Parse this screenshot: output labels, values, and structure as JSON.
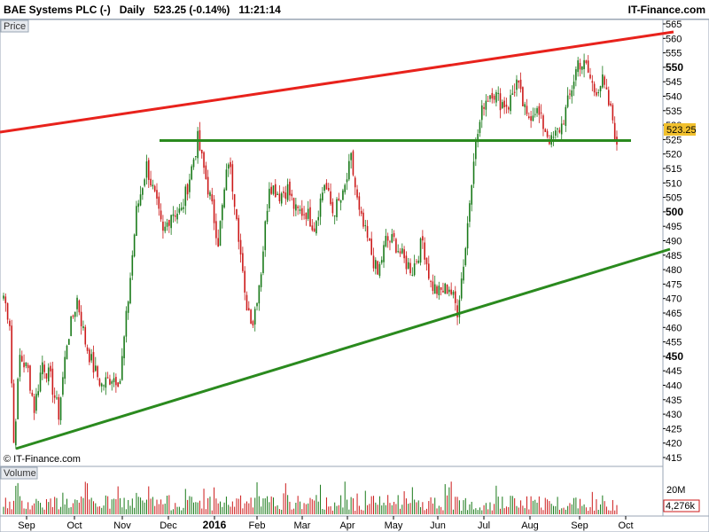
{
  "header": {
    "title": "BAE Systems PLC (-)   Daily   523.25 (-0.14%)   11:21:14",
    "brand": "IT-Finance.com"
  },
  "panes": {
    "price_label": "Price",
    "volume_label": "Volume",
    "copyright": "© IT-Finance.com"
  },
  "colors": {
    "up": "#1a7a1a",
    "down": "#cc1a1a",
    "resistance": "#e8221c",
    "support": "#2a8a1e",
    "horizontal": "#2a8a1e",
    "last_badge": "#f2c12e",
    "volume_badge": "#cc1a1a"
  },
  "chart_data": {
    "type": "candlestick",
    "y_range": [
      415,
      565
    ],
    "y_ticks": [
      415,
      420,
      425,
      430,
      435,
      440,
      445,
      450,
      455,
      460,
      465,
      470,
      475,
      480,
      485,
      490,
      495,
      500,
      505,
      510,
      515,
      520,
      525,
      530,
      535,
      540,
      545,
      550,
      555,
      560,
      565
    ],
    "y_bold": [
      450,
      500,
      550
    ],
    "x_labels": [
      "Sep",
      "Oct",
      "Nov",
      "Dec",
      "2016",
      "Feb",
      "Mar",
      "Apr",
      "May",
      "Jun",
      "Jul",
      "Aug",
      "Sep",
      "Oct"
    ],
    "x_bold": [
      "2016"
    ],
    "last_price": "523.25",
    "volume_ticks": [
      "20M"
    ],
    "last_volume": "4,276k",
    "anchors": [
      [
        0,
        471
      ],
      [
        3,
        462
      ],
      [
        5,
        420
      ],
      [
        8,
        450
      ],
      [
        12,
        445
      ],
      [
        15,
        432
      ],
      [
        19,
        448
      ],
      [
        23,
        442
      ],
      [
        27,
        430
      ],
      [
        31,
        455
      ],
      [
        36,
        470
      ],
      [
        40,
        455
      ],
      [
        44,
        446
      ],
      [
        48,
        440
      ],
      [
        53,
        443
      ],
      [
        57,
        442
      ],
      [
        61,
        470
      ],
      [
        65,
        500
      ],
      [
        70,
        516
      ],
      [
        74,
        505
      ],
      [
        78,
        492
      ],
      [
        82,
        500
      ],
      [
        87,
        500
      ],
      [
        91,
        512
      ],
      [
        95,
        525
      ],
      [
        97,
        518
      ],
      [
        101,
        505
      ],
      [
        105,
        490
      ],
      [
        110,
        518
      ],
      [
        114,
        500
      ],
      [
        118,
        470
      ],
      [
        122,
        462
      ],
      [
        126,
        480
      ],
      [
        130,
        510
      ],
      [
        135,
        506
      ],
      [
        139,
        508
      ],
      [
        143,
        500
      ],
      [
        148,
        500
      ],
      [
        152,
        495
      ],
      [
        157,
        510
      ],
      [
        161,
        500
      ],
      [
        166,
        505
      ],
      [
        170,
        518
      ],
      [
        174,
        499
      ],
      [
        179,
        488
      ],
      [
        183,
        478
      ],
      [
        187,
        490
      ],
      [
        191,
        490
      ],
      [
        196,
        483
      ],
      [
        200,
        480
      ],
      [
        205,
        490
      ],
      [
        209,
        475
      ],
      [
        213,
        472
      ],
      [
        218,
        474
      ],
      [
        222,
        466
      ],
      [
        226,
        488
      ],
      [
        230,
        520
      ],
      [
        235,
        538
      ],
      [
        239,
        542
      ],
      [
        243,
        538
      ],
      [
        247,
        537
      ],
      [
        251,
        545
      ],
      [
        256,
        532
      ],
      [
        260,
        536
      ],
      [
        264,
        530
      ],
      [
        268,
        524
      ],
      [
        273,
        530
      ],
      [
        277,
        540
      ],
      [
        281,
        552
      ],
      [
        285,
        550
      ],
      [
        289,
        542
      ],
      [
        293,
        545
      ],
      [
        298,
        532
      ],
      [
        300,
        523
      ]
    ]
  }
}
